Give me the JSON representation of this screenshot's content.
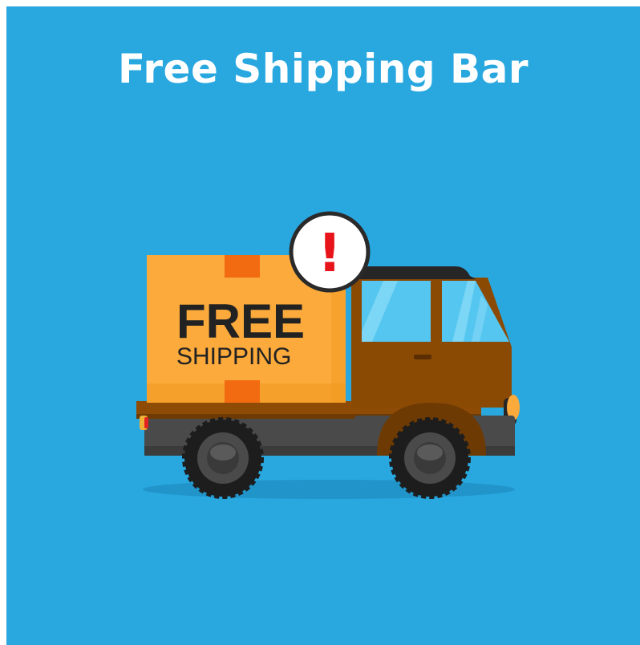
{
  "title": "Free Shipping Bar",
  "box": {
    "line1": "FREE",
    "line2": "SHIPPING"
  },
  "alert": {
    "symbol": "!",
    "icon": "exclamation-badge-icon"
  },
  "colors": {
    "background": "#29a8e0",
    "box": "#fbaa3b",
    "box_tape": "#f26b11",
    "cab": "#8b4a04",
    "window": "#55c6f0",
    "alert_red": "#e8141b"
  }
}
